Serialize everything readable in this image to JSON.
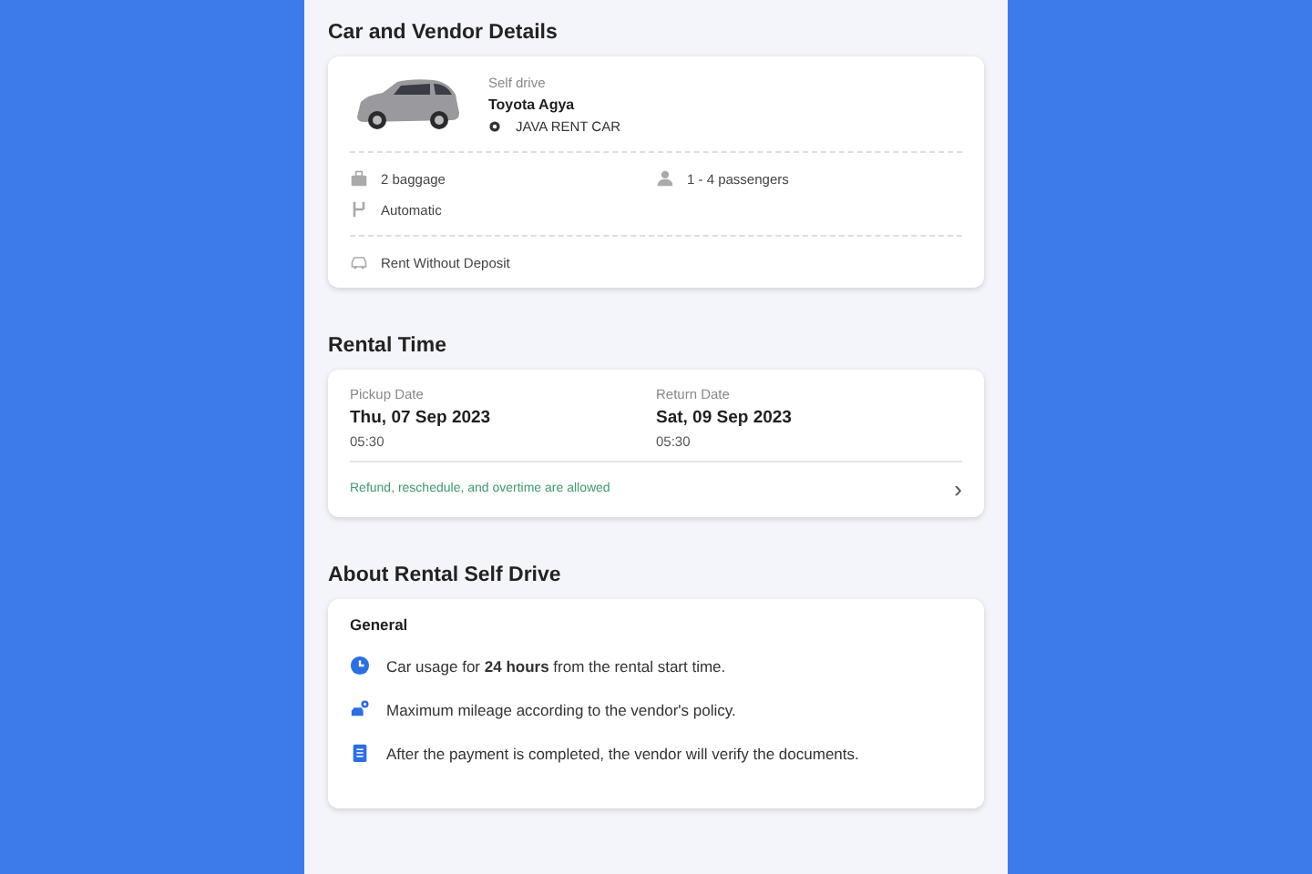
{
  "car_section": {
    "title": "Car and Vendor Details",
    "type": "Self drive",
    "model": "Toyota Agya",
    "vendor": "JAVA RENT CAR",
    "features": [
      {
        "kind": "baggage",
        "label": "2 baggage"
      },
      {
        "kind": "passengers",
        "label": "1 - 4 passengers"
      },
      {
        "kind": "transmission",
        "label": "Automatic"
      }
    ],
    "policy": {
      "kind": "deposit",
      "label": "Rent Without Deposit"
    }
  },
  "rental_time": {
    "title": "Rental Time",
    "dates": [
      {
        "label": "Pickup Date",
        "date": "Thu, 07 Sep 2023",
        "time": "05:30"
      },
      {
        "label": "Return Date",
        "date": "Sat, 09 Sep 2023",
        "time": "05:30"
      }
    ],
    "note": "Refund, reschedule, and overtime are allowed",
    "chevron": "›"
  },
  "about": {
    "title": "About Rental Self Drive",
    "subtitle": "General",
    "items": [
      {
        "kind": "clock",
        "text": "Car usage for **24 hours** from the rental start time."
      },
      {
        "kind": "mileage",
        "text": "Maximum mileage according to the vendor's policy."
      },
      {
        "kind": "document",
        "text": "After the payment is completed, the vendor will verify the documents."
      }
    ]
  }
}
